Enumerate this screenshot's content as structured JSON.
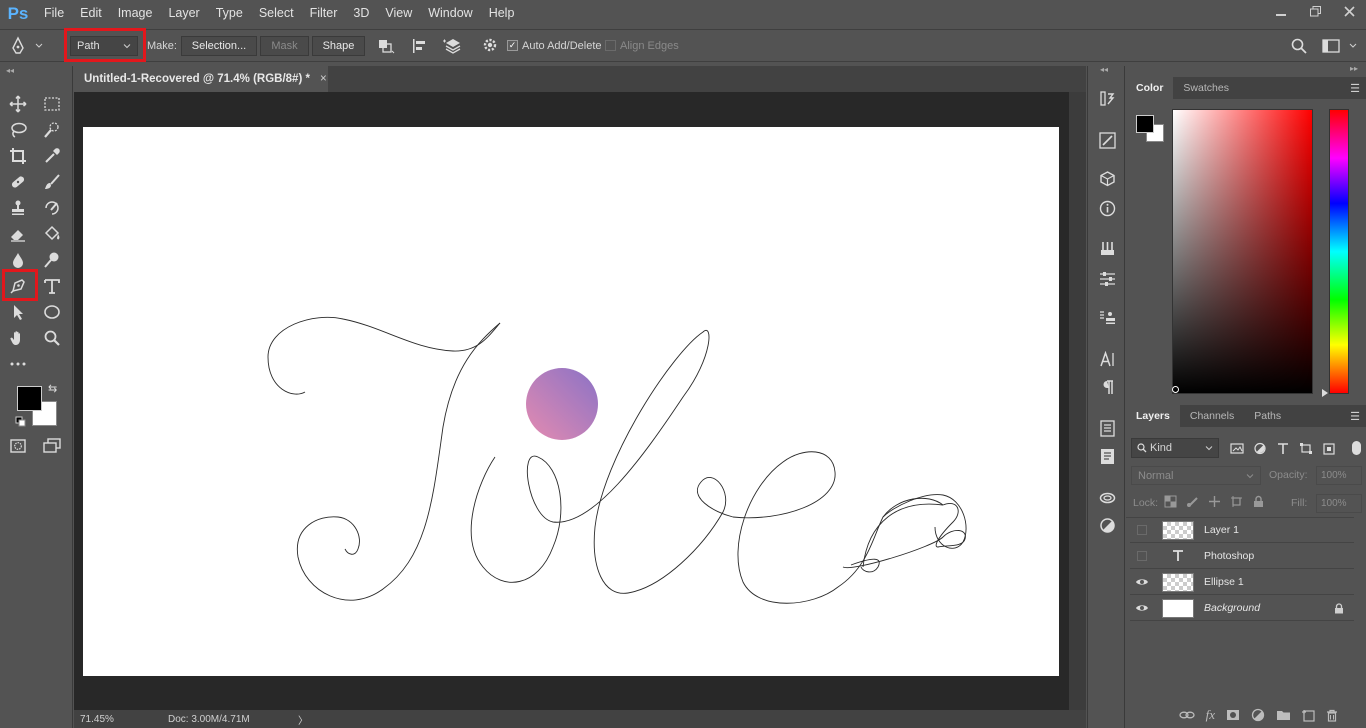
{
  "app": {
    "logo": "Ps",
    "menu": [
      "File",
      "Edit",
      "Image",
      "Layer",
      "Type",
      "Select",
      "Filter",
      "3D",
      "View",
      "Window",
      "Help"
    ]
  },
  "options_bar": {
    "mode_value": "Path",
    "make_label": "Make:",
    "selection_button": "Selection...",
    "mask_button": "Mask",
    "shape_button": "Shape",
    "auto_add_delete": "Auto Add/Delete",
    "auto_add_delete_checked": true,
    "align_edges": "Align Edges",
    "align_edges_checked": false
  },
  "document": {
    "tab_title": "Untitled-1-Recovered @ 71.4% (RGB/8#) *",
    "tab_close": "×"
  },
  "status_bar": {
    "zoom": "71.45%",
    "doc_size": "Doc: 3.00M/4.71M",
    "arrow": "〉"
  },
  "color_panel": {
    "tabs": [
      "Color",
      "Swatches"
    ],
    "foreground": "#000000",
    "background": "#ffffff"
  },
  "layers_panel": {
    "tabs": [
      "Layers",
      "Channels",
      "Paths"
    ],
    "filter_kind": "Kind",
    "blend_mode": "Normal",
    "opacity_label": "Opacity:",
    "opacity_value": "100%",
    "lock_label": "Lock:",
    "fill_label": "Fill:",
    "fill_value": "100%",
    "layers": [
      {
        "name": "Layer 1",
        "visible": false,
        "thumb": "checker"
      },
      {
        "name": "Photoshop",
        "visible": false,
        "thumb": "type"
      },
      {
        "name": "Ellipse 1",
        "visible": true,
        "thumb": "checker"
      },
      {
        "name": "Background",
        "visible": true,
        "thumb": "white",
        "locked": true
      }
    ]
  },
  "canvas": {
    "ellipse_gradient": [
      "#e58bb0",
      "#8a72c6"
    ]
  }
}
